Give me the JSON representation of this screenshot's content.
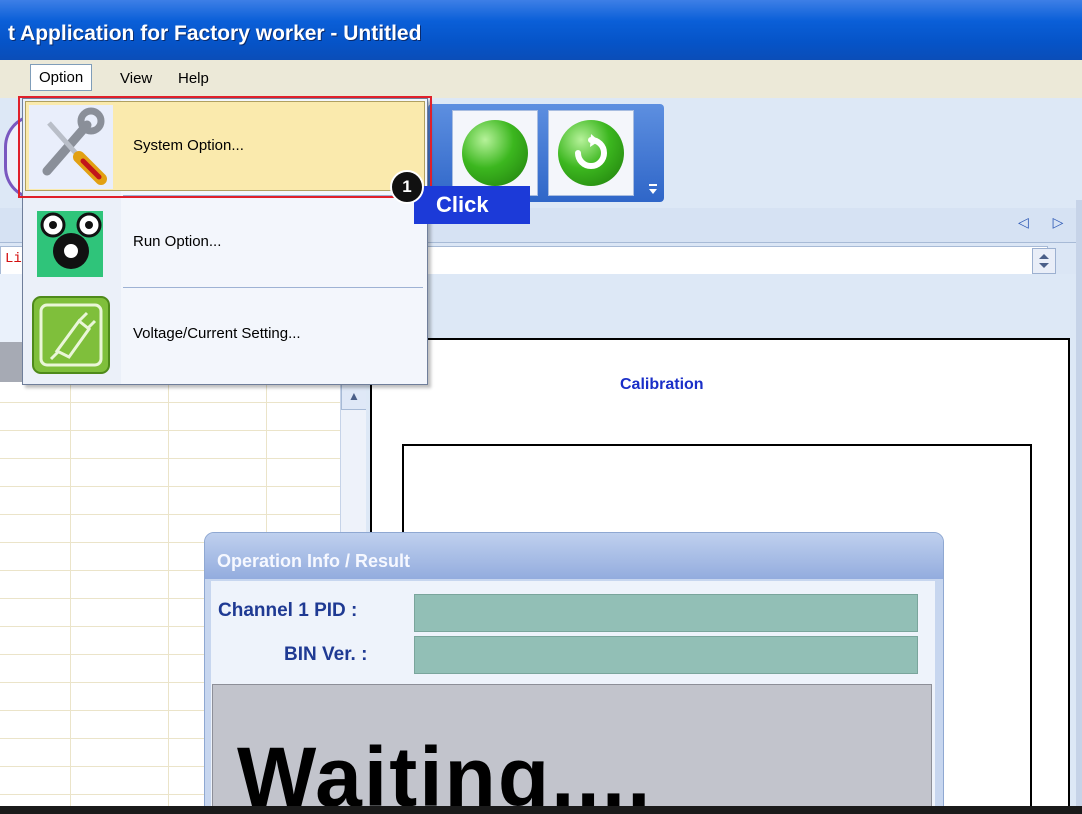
{
  "window": {
    "title": "t Application for Factory worker - Untitled"
  },
  "menubar": {
    "items": [
      {
        "label": "Option",
        "mnemonic": "O"
      },
      {
        "label": "View",
        "mnemonic": "V"
      },
      {
        "label": "Help",
        "mnemonic": "H"
      }
    ]
  },
  "dropdown": {
    "items": [
      {
        "label": "System Option...",
        "icon": "tools-icon",
        "highlighted": true
      },
      {
        "label": "Run Option...",
        "icon": "gears-icon"
      },
      {
        "label": "Voltage/Current Setting...",
        "icon": "plug-icon"
      }
    ]
  },
  "toolbar": {
    "buttons": [
      {
        "icon": "green-circle-icon"
      },
      {
        "icon": "refresh-icon"
      }
    ]
  },
  "address": {
    "text": "Li"
  },
  "nav": {
    "arrows": "◁ ▷"
  },
  "chart": {
    "title": "Calibration"
  },
  "operation": {
    "title": "Operation Info / Result",
    "channel_label": "Channel 1 PID :",
    "channel_value": "",
    "bin_label": "BIN Ver. :",
    "bin_value": "",
    "result_text": "Waiting...."
  },
  "annotation": {
    "step": "1",
    "action": "Click"
  },
  "colors": {
    "highlight": "#faeaad",
    "annotation_blue": "#1c3ad8",
    "annotation_red": "#e0202a",
    "field_teal": "#92bfb6"
  }
}
